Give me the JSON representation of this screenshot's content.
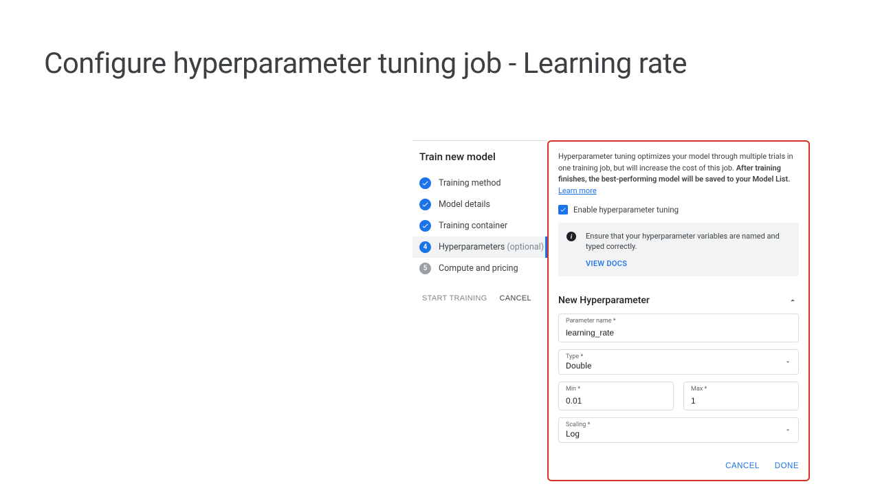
{
  "page": {
    "title": "Configure hyperparameter tuning job - Learning rate"
  },
  "stepper": {
    "title": "Train new model",
    "steps": [
      {
        "label": "Training method",
        "state": "done"
      },
      {
        "label": "Model details",
        "state": "done"
      },
      {
        "label": "Training container",
        "state": "done"
      },
      {
        "label": "Hyperparameters",
        "optional": "(optional)",
        "state": "current",
        "number": "4"
      },
      {
        "label": "Compute and pricing",
        "state": "pending",
        "number": "5"
      }
    ],
    "start_training": "START TRAINING",
    "cancel": "CANCEL"
  },
  "panel": {
    "intro_prefix": "Hyperparameter tuning optimizes your model through multiple trials in one training job, but will increase the cost of this job. ",
    "intro_bold": "After training finishes, the best-performing model will be saved to your Model List.",
    "learn_more": "Learn more",
    "enable_label": "Enable hyperparameter tuning",
    "info_text": "Ensure that your hyperparameter variables are named and typed correctly.",
    "view_docs": "VIEW DOCS",
    "hp_title": "New Hyperparameter",
    "fields": {
      "param_name_label": "Parameter name *",
      "param_name_value": "learning_rate",
      "type_label": "Type *",
      "type_value": "Double",
      "min_label": "Min *",
      "min_value": "0.01",
      "max_label": "Max *",
      "max_value": "1",
      "scaling_label": "Scaling *",
      "scaling_value": "Log"
    },
    "cancel": "CANCEL",
    "done": "DONE"
  }
}
